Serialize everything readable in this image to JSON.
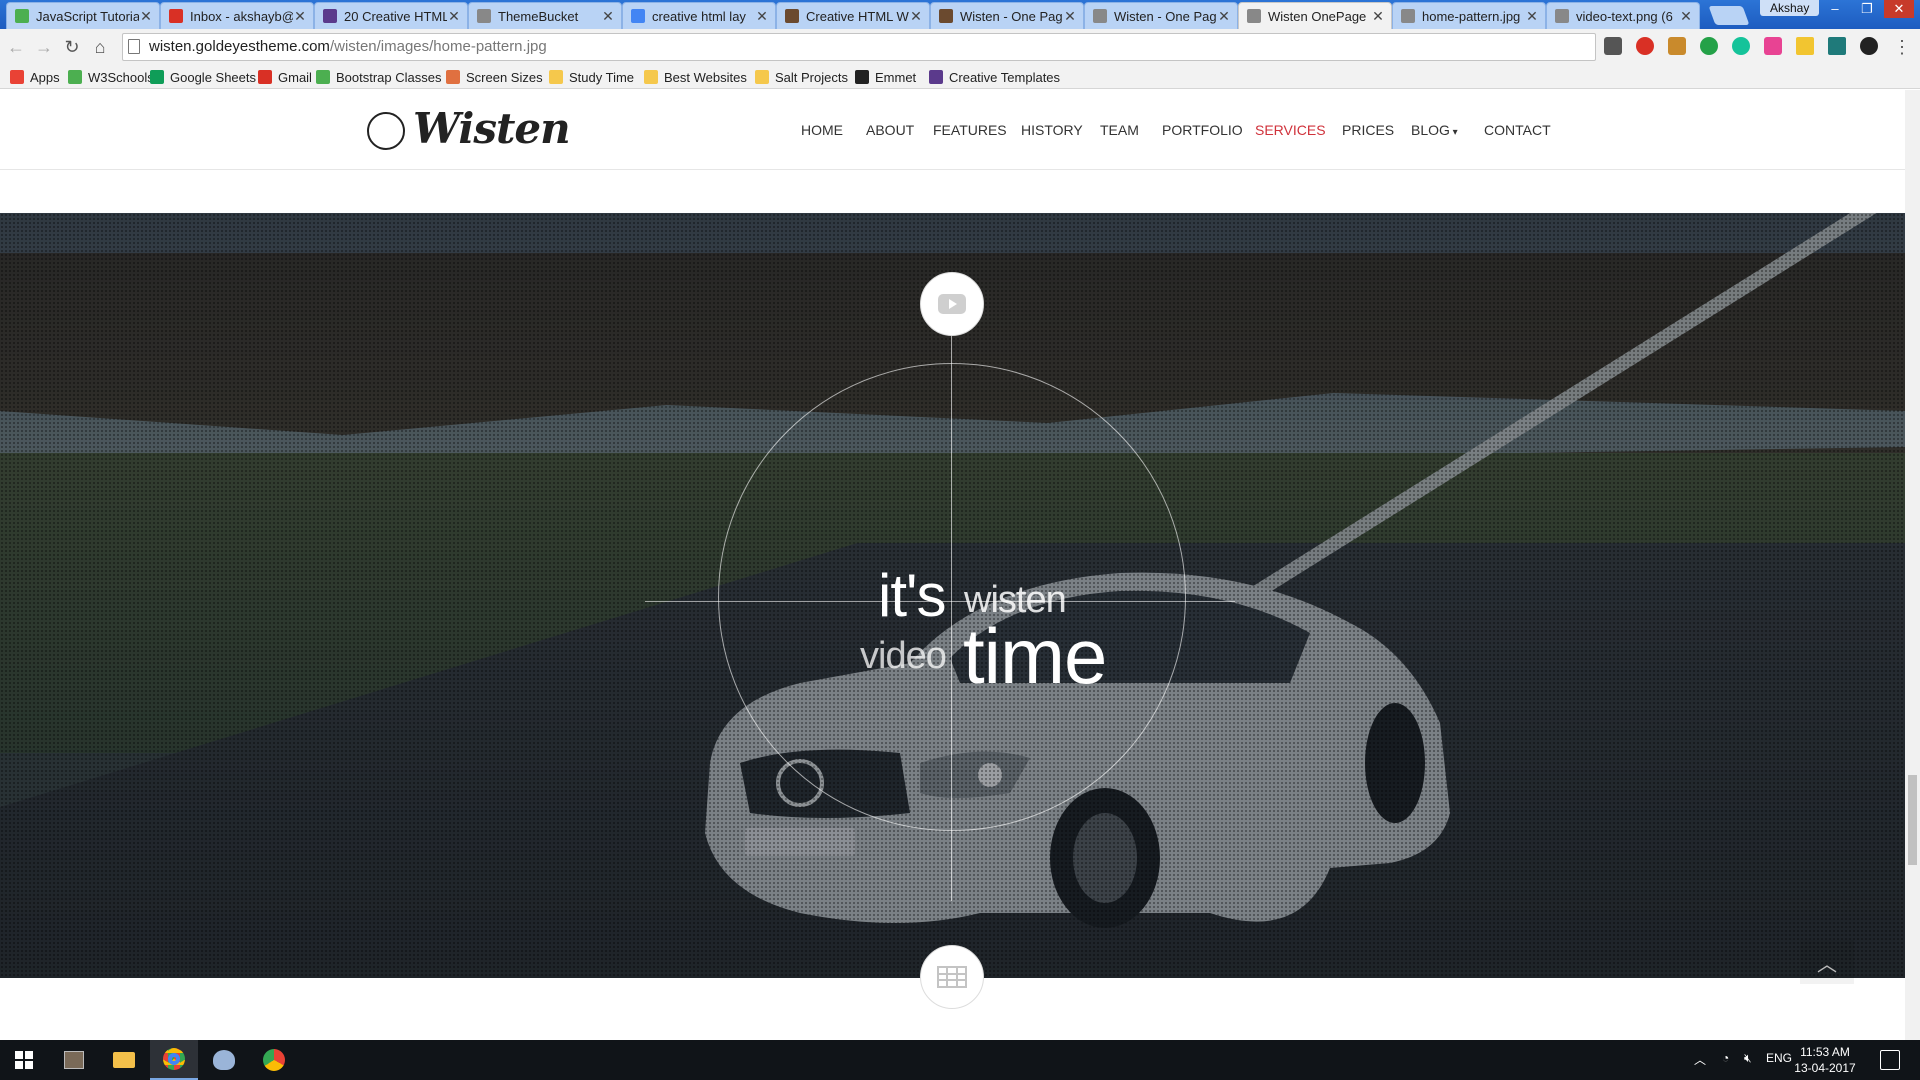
{
  "browser": {
    "tabs": [
      {
        "title": "JavaScript Tutoria",
        "favicon": "w3schools-icon",
        "color": "#4caf50"
      },
      {
        "title": "Inbox - akshayb@",
        "favicon": "gmail-icon",
        "color": "#d93025"
      },
      {
        "title": "20 Creative HTML",
        "favicon": "purple-site-icon",
        "color": "#5b3a8c"
      },
      {
        "title": "ThemeBucket",
        "favicon": "page-icon",
        "color": "#888888"
      },
      {
        "title": "creative html lay",
        "favicon": "google-icon",
        "color": "#4285f4"
      },
      {
        "title": "Creative HTML W",
        "favicon": "image-icon",
        "color": "#6b4a2f"
      },
      {
        "title": "Wisten - One Pag",
        "favicon": "image-icon",
        "color": "#6b4a2f"
      },
      {
        "title": "Wisten - One Pag",
        "favicon": "page-icon",
        "color": "#888888"
      },
      {
        "title": "Wisten OnePage",
        "favicon": "page-icon",
        "color": "#888888",
        "active": true
      },
      {
        "title": "home-pattern.jpg",
        "favicon": "page-icon",
        "color": "#888888"
      },
      {
        "title": "video-text.png (6",
        "favicon": "page-icon",
        "color": "#888888"
      }
    ],
    "user": "Akshay",
    "url_host": "wisten.goldeyestheme.com",
    "url_path": "/wisten/images/home-pattern.jpg",
    "bookmarks": [
      {
        "label": "Apps",
        "icon": "apps-grid-icon",
        "color": "#e94235"
      },
      {
        "label": "W3Schools",
        "icon": "w3schools-icon",
        "color": "#4caf50"
      },
      {
        "label": "Google Sheets",
        "icon": "sheets-icon",
        "color": "#0f9d58"
      },
      {
        "label": "Gmail",
        "icon": "gmail-icon",
        "color": "#d93025"
      },
      {
        "label": "Bootstrap Classes",
        "icon": "w3schools-icon",
        "color": "#4caf50"
      },
      {
        "label": "Screen Sizes",
        "icon": "screen-sizes-icon",
        "color": "#e07040"
      },
      {
        "label": "Study Time",
        "icon": "folder-icon",
        "color": "#f5c84c"
      },
      {
        "label": "Best Websites",
        "icon": "folder-icon",
        "color": "#f5c84c"
      },
      {
        "label": "Salt Projects",
        "icon": "folder-icon",
        "color": "#f5c84c"
      },
      {
        "label": "Emmet",
        "icon": "emmet-icon",
        "color": "#222222"
      },
      {
        "label": "Creative Templates",
        "icon": "purple-site-icon",
        "color": "#5b3a8c"
      }
    ]
  },
  "site": {
    "logo": "Wisten",
    "nav": [
      "HOME",
      "ABOUT",
      "FEATURES",
      "HISTORY",
      "TEAM",
      "PORTFOLIO",
      "SERVICES",
      "PRICES",
      "BLOG",
      "CONTACT"
    ],
    "active_nav": "SERVICES",
    "accent_color": "#d0323b",
    "hero": {
      "word_its": "it's",
      "word_wisten": "wisten",
      "word_video": "video",
      "word_time": "time"
    }
  },
  "taskbar": {
    "language": "ENG",
    "time": "11:53 AM",
    "date": "13-04-2017"
  }
}
